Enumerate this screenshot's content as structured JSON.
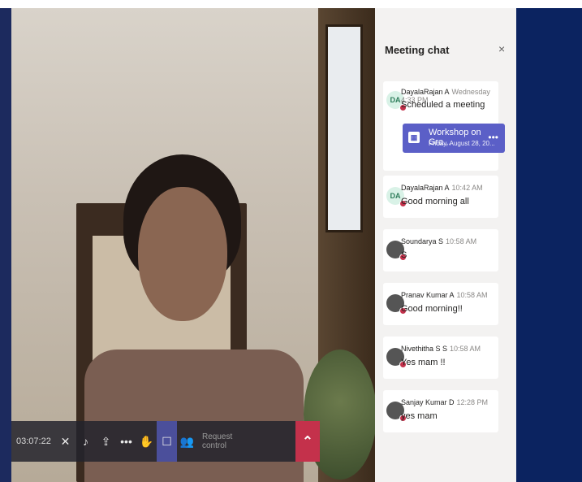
{
  "meeting": {
    "timer": "03:07:22",
    "request_control": "Request control"
  },
  "controls": [
    {
      "name": "camera-off-icon",
      "glyph": "✕"
    },
    {
      "name": "mic-off-icon",
      "glyph": "♪"
    },
    {
      "name": "share-screen-icon",
      "glyph": "⇪"
    },
    {
      "name": "more-options-icon",
      "glyph": "•••"
    },
    {
      "name": "raise-hand-icon",
      "glyph": "✋"
    },
    {
      "name": "chat-icon",
      "glyph": "☐"
    },
    {
      "name": "participants-icon",
      "glyph": "👥"
    }
  ],
  "chat": {
    "title": "Meeting chat",
    "close": "×",
    "messages": [
      {
        "sender": "DayalaRajan A",
        "time": "Wednesday 4:33 PM",
        "text": "Scheduled a meeting",
        "initials": "DA",
        "card": {
          "title": "Workshop on Gra...",
          "subtitle": "Friday, August 28, 20..."
        }
      },
      {
        "sender": "DayalaRajan A",
        "time": "10:42 AM",
        "text": "Good morning all",
        "initials": "DA"
      },
      {
        "sender": "Soundarya S",
        "time": "10:58 AM",
        "text": "S",
        "initials": ""
      },
      {
        "sender": "Pranav Kumar A",
        "time": "10:58 AM",
        "text": "Good morning!!",
        "initials": ""
      },
      {
        "sender": "Nivethitha S S",
        "time": "10:58 AM",
        "text": "Yes mam !!",
        "initials": ""
      },
      {
        "sender": "Sanjay Kumar D",
        "time": "12:28 PM",
        "text": "yes mam",
        "initials": ""
      }
    ]
  }
}
